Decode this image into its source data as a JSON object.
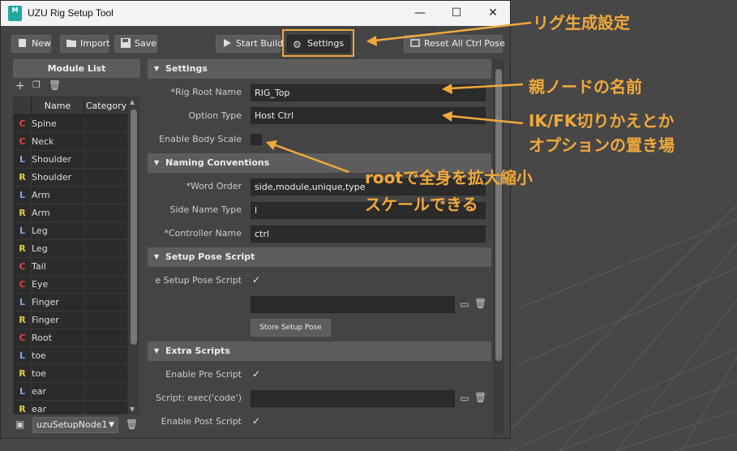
{
  "window": {
    "title": "UZU Rig Setup Tool",
    "icon_text": "M",
    "controls": [
      "—",
      "☐",
      "✕"
    ]
  },
  "toolbar": {
    "new_label": "New",
    "import_label": "Import",
    "save_label": "Save",
    "start_build_label": "Start Build",
    "settings_label": "Settings",
    "reset_label": "Reset All Ctrl Pose"
  },
  "module_list": {
    "title": "Module List",
    "columns": [
      "Name",
      "Category"
    ],
    "rows": [
      {
        "side": "C",
        "name": "Spine"
      },
      {
        "side": "C",
        "name": "Neck"
      },
      {
        "side": "L",
        "name": "Shoulder"
      },
      {
        "side": "R",
        "name": "Shoulder"
      },
      {
        "side": "L",
        "name": "Arm"
      },
      {
        "side": "R",
        "name": "Arm"
      },
      {
        "side": "L",
        "name": "Leg"
      },
      {
        "side": "R",
        "name": "Leg"
      },
      {
        "side": "C",
        "name": "Tail"
      },
      {
        "side": "C",
        "name": "Eye"
      },
      {
        "side": "L",
        "name": "Finger"
      },
      {
        "side": "R",
        "name": "Finger"
      },
      {
        "side": "C",
        "name": "Root"
      },
      {
        "side": "L",
        "name": "toe"
      },
      {
        "side": "R",
        "name": "toe"
      },
      {
        "side": "L",
        "name": "ear"
      },
      {
        "side": "R",
        "name": "ear"
      }
    ],
    "node_selector": "uzuSetupNode1"
  },
  "settings": {
    "sections": {
      "settings": "Settings",
      "naming": "Naming Conventions",
      "setup_pose": "Setup Pose Script",
      "extra": "Extra Scripts"
    },
    "rig_root_name_label": "*Rig Root Name",
    "rig_root_name_value": "RIG_Top",
    "option_type_label": "Option Type",
    "option_type_value": "Host Ctrl",
    "enable_body_scale_label": "Enable Body Scale",
    "word_order_label": "*Word Order",
    "word_order_value": "side,module,unique,type",
    "side_name_type_label": "Side Name Type",
    "side_name_type_value": "l",
    "controller_name_label": "*Controller Name",
    "controller_name_value": "ctrl",
    "setup_pose_script_label": "e Setup Pose Script",
    "store_setup_pose_label": "Store Setup Pose",
    "enable_pre_script_label": "Enable Pre Script",
    "script_exec_label": "Script: exec('code')",
    "enable_post_script_label": "Enable Post Script"
  },
  "annotations": {
    "rig_settings": "リグ生成設定",
    "root_node_name": "親ノードの名前",
    "ikfk_line1": "IK/FK切りかえとか",
    "ikfk_line2": "オプションの置き場",
    "scale_line1": "rootで全身を拡大縮小",
    "scale_line2": "スケールできる"
  },
  "colors": {
    "accent": "#f2a93b",
    "side_center": "#e0463c",
    "side_left": "#7fa6e6",
    "side_right": "#e1cc45"
  }
}
